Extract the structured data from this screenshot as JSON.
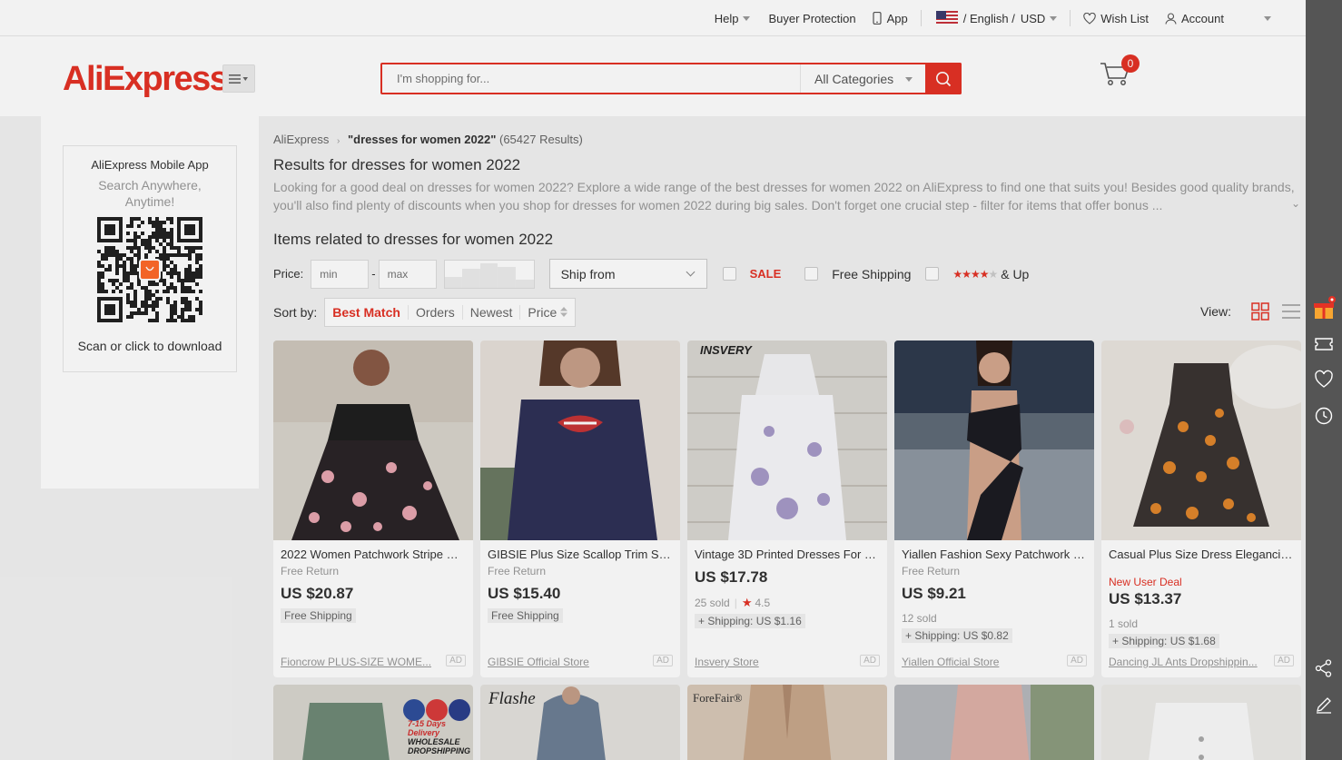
{
  "topbar": {
    "help": "Help",
    "buyer_protection": "Buyer Protection",
    "app": "App",
    "lang": "/ English /",
    "currency": "USD",
    "wishlist": "Wish List",
    "account": "Account"
  },
  "header": {
    "logo": "AliExpress",
    "search_placeholder": "I'm shopping for...",
    "category": "All Categories",
    "cart_count": "0"
  },
  "sidebar": {
    "app_title": "AliExpress Mobile App",
    "app_sub": "Search Anywhere, Anytime!",
    "download": "Scan or click to download"
  },
  "main": {
    "breadcrumb_root": "AliExpress",
    "breadcrumb_query": "\"dresses for women 2022\"",
    "breadcrumb_count": "(65427 Results)",
    "results_title": "Results for dresses for women 2022",
    "description": "Looking for a good deal on dresses for women 2022? Explore a wide range of the best dresses for women 2022 on AliExpress to find one that suits you! Besides good quality brands, you'll also find plenty of discounts when you shop for dresses for women 2022 during big sales. Don't forget one crucial step - filter for items that offer bonus ...",
    "related_title": "Items related to dresses for women 2022"
  },
  "filters": {
    "price_label": "Price:",
    "min_placeholder": "min",
    "dash": "-",
    "max_placeholder": "max",
    "ship_from": "Ship from",
    "sale": "SALE",
    "free_shipping": "Free Shipping",
    "and_up": "& Up"
  },
  "sort": {
    "label": "Sort by:",
    "options": [
      "Best Match",
      "Orders",
      "Newest",
      "Price"
    ],
    "view_label": "View:"
  },
  "products": [
    {
      "title": "2022 Women Patchwork Stripe Ne...",
      "sub": "Free Return",
      "price": "US $20.87",
      "tag": "Free Shipping",
      "store": "Fioncrow PLUS-SIZE WOME...",
      "ad": "AD"
    },
    {
      "title": "GIBSIE Plus Size Scallop Trim Sequi...",
      "sub": "Free Return",
      "price": "US $15.40",
      "tag": "Free Shipping",
      "store": "GIBSIE Official Store",
      "ad": "AD"
    },
    {
      "title": "Vintage 3D Printed Dresses For W...",
      "price": "US $17.78",
      "sold": "25 sold",
      "rating": "4.5",
      "shipping": "+ Shipping: US $1.16",
      "store": "Insvery Store",
      "ad": "AD",
      "brand": "INSVERY"
    },
    {
      "title": "Yiallen Fashion Sexy Patchwork Mi...",
      "sub": "Free Return",
      "price": "US $9.21",
      "sold": "12 sold",
      "shipping": "+ Shipping: US $0.82",
      "store": "Yiallen Official Store",
      "ad": "AD"
    },
    {
      "title": "Casual Plus Size Dress Elegancia M...",
      "deal": "New User Deal",
      "price": "US $13.37",
      "sold": "1 sold",
      "shipping": "+ Shipping: US $1.68",
      "store": "Dancing JL Ants Dropshippin...",
      "ad": "AD"
    }
  ],
  "row2": {
    "badge_line1": "7-15 Days Delivery",
    "badge_line2": "WHOLESALE",
    "badge_line3": "DROPSHIPPING",
    "brand2": "Flashe",
    "brand3": "ForeFair®"
  },
  "colors": {
    "accent": "#e43225",
    "rail": "#555555"
  }
}
